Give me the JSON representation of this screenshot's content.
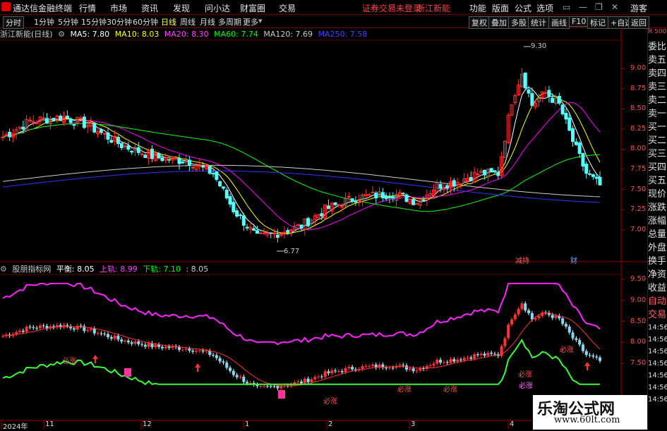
{
  "menu": {
    "app_title": "通达信金融终端",
    "items": [
      "行情",
      "市场",
      "资讯",
      "发现",
      "问小达",
      "财富圈",
      "交易"
    ],
    "login_status": "证券交易未登录",
    "stock_name": "浙江新能",
    "right_items": [
      "功能",
      "版面",
      "公式",
      "选项"
    ],
    "user": "游客"
  },
  "tabs": {
    "periods": [
      "分时",
      "1分钟",
      "5分钟",
      "15分钟",
      "30分钟",
      "60分钟",
      "日线",
      "周线",
      "月线",
      "多周期",
      "更多"
    ],
    "active": "日线",
    "tools": [
      "复权",
      "叠加",
      "多股",
      "统计",
      "画线",
      "F10",
      "标记",
      "+自选",
      "返回"
    ]
  },
  "main_info": {
    "name": "浙江新能(日线)",
    "ma5": "MA5: 7.80",
    "ma10": "MA10: 8.03",
    "ma20": "MA20: 8.30",
    "ma60": "MA60: 7.74",
    "ma120": "MA120: 7.69",
    "ma250": "MA250: 7.58"
  },
  "osc_info": {
    "name": "股朋指标网",
    "mid": "平衡: 8.05",
    "upper": "上轨: 8.99",
    "lower": "下轨: 7.10",
    "extra": ": 8.05"
  },
  "right_panel": {
    "top": "R 500",
    "items": [
      "委比",
      "卖五",
      "卖四",
      "卖三",
      "卖二",
      "卖一",
      "买一",
      "买二",
      "买三",
      "买四",
      "买五",
      "现价",
      "涨跌",
      "涨幅",
      "总量",
      "外盘",
      "换手",
      "净资",
      "收益",
      "自动",
      "交易",
      "14:56",
      "14:56",
      "14:56",
      "14:56",
      "14:56",
      "14:56",
      "14:56"
    ]
  },
  "annotations": {
    "high": "9.30",
    "low": "6.77",
    "event1": "减持",
    "event2": "财",
    "buy_labels": [
      "必涨",
      "必涨",
      "必涨",
      "必涨",
      "必涨",
      "必涨",
      "必涨"
    ]
  },
  "price_axis": [
    "9.00",
    "8.75",
    "8.50",
    "8.25",
    "8.00",
    "7.75",
    "7.50",
    "7.25",
    "7.00"
  ],
  "osc_axis": [
    "9.50",
    "9.00",
    "8.50",
    "8.00",
    "7.50"
  ],
  "dates": [
    "2024年",
    "11",
    "12",
    "1",
    "2",
    "3",
    "4"
  ],
  "watermark": {
    "line1": "乐淘公式网",
    "line2": "www.60lt.com"
  },
  "colors": {
    "up": "#ff3232",
    "down": "#54ffff",
    "ma5": "#ffffff",
    "ma10": "#ffff00",
    "ma20": "#ff00ff",
    "ma60": "#00ff00",
    "ma120": "#cccccc",
    "ma250": "#3333ff"
  }
}
